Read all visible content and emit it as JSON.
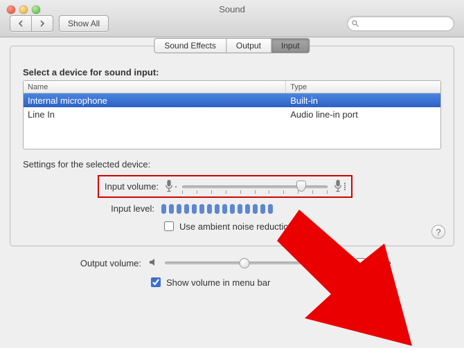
{
  "window": {
    "title": "Sound"
  },
  "toolbar": {
    "show_all_label": "Show All",
    "search_placeholder": ""
  },
  "tabs": [
    {
      "label": "Sound Effects",
      "selected": false
    },
    {
      "label": "Output",
      "selected": false
    },
    {
      "label": "Input",
      "selected": true
    }
  ],
  "input_section": {
    "heading": "Select a device for sound input:",
    "columns": {
      "name": "Name",
      "type": "Type"
    },
    "devices": [
      {
        "name": "Internal microphone",
        "type": "Built-in",
        "selected": true
      },
      {
        "name": "Line In",
        "type": "Audio line-in port",
        "selected": false
      }
    ]
  },
  "settings": {
    "heading": "Settings for the selected device:",
    "input_volume_label": "Input volume:",
    "input_volume_percent": 82,
    "input_level_label": "Input level:",
    "input_level_segments": 15,
    "input_level_active": 15,
    "ambient_checkbox_label": "Use ambient noise reduction",
    "ambient_checked": false
  },
  "output": {
    "output_volume_label": "Output volume:",
    "output_volume_percent": 50,
    "mute_label": "Mute",
    "mute_checked": false,
    "menubar_label": "Show volume in menu bar",
    "menubar_checked": true
  },
  "help_label": "?"
}
